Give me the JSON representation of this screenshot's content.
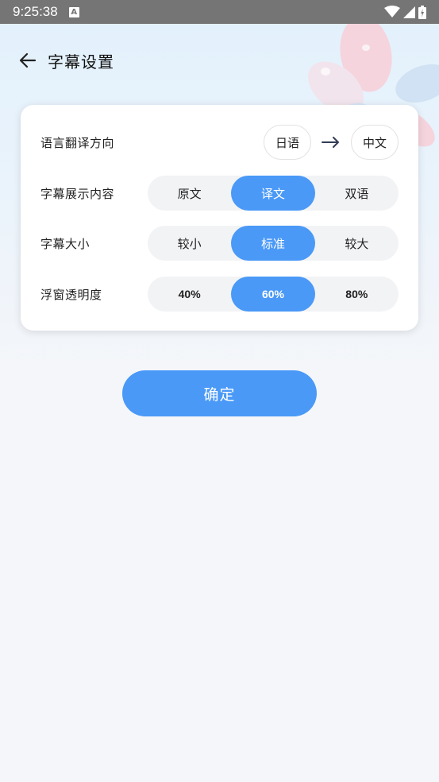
{
  "status_bar": {
    "time": "9:25:38",
    "notification_badge": "A",
    "icons": [
      "wifi-icon",
      "signal-icon",
      "battery-icon"
    ]
  },
  "header": {
    "back_icon": "arrow-left-icon",
    "title": "字幕设置"
  },
  "settings": {
    "translation": {
      "label": "语言翻译方向",
      "source": "日语",
      "target": "中文",
      "arrow_icon": "arrow-right-icon"
    },
    "display_content": {
      "label": "字幕展示内容",
      "options": [
        "原文",
        "译文",
        "双语"
      ],
      "selected": "译文"
    },
    "font_size": {
      "label": "字幕大小",
      "options": [
        "较小",
        "标准",
        "较大"
      ],
      "selected": "标准"
    },
    "opacity": {
      "label": "浮窗透明度",
      "options": [
        "40%",
        "60%",
        "80%"
      ],
      "selected": "60%"
    }
  },
  "confirm_label": "确定",
  "colors": {
    "accent": "#4a99f7",
    "segment_bg": "#f2f3f5",
    "status_bar": "#757575"
  }
}
